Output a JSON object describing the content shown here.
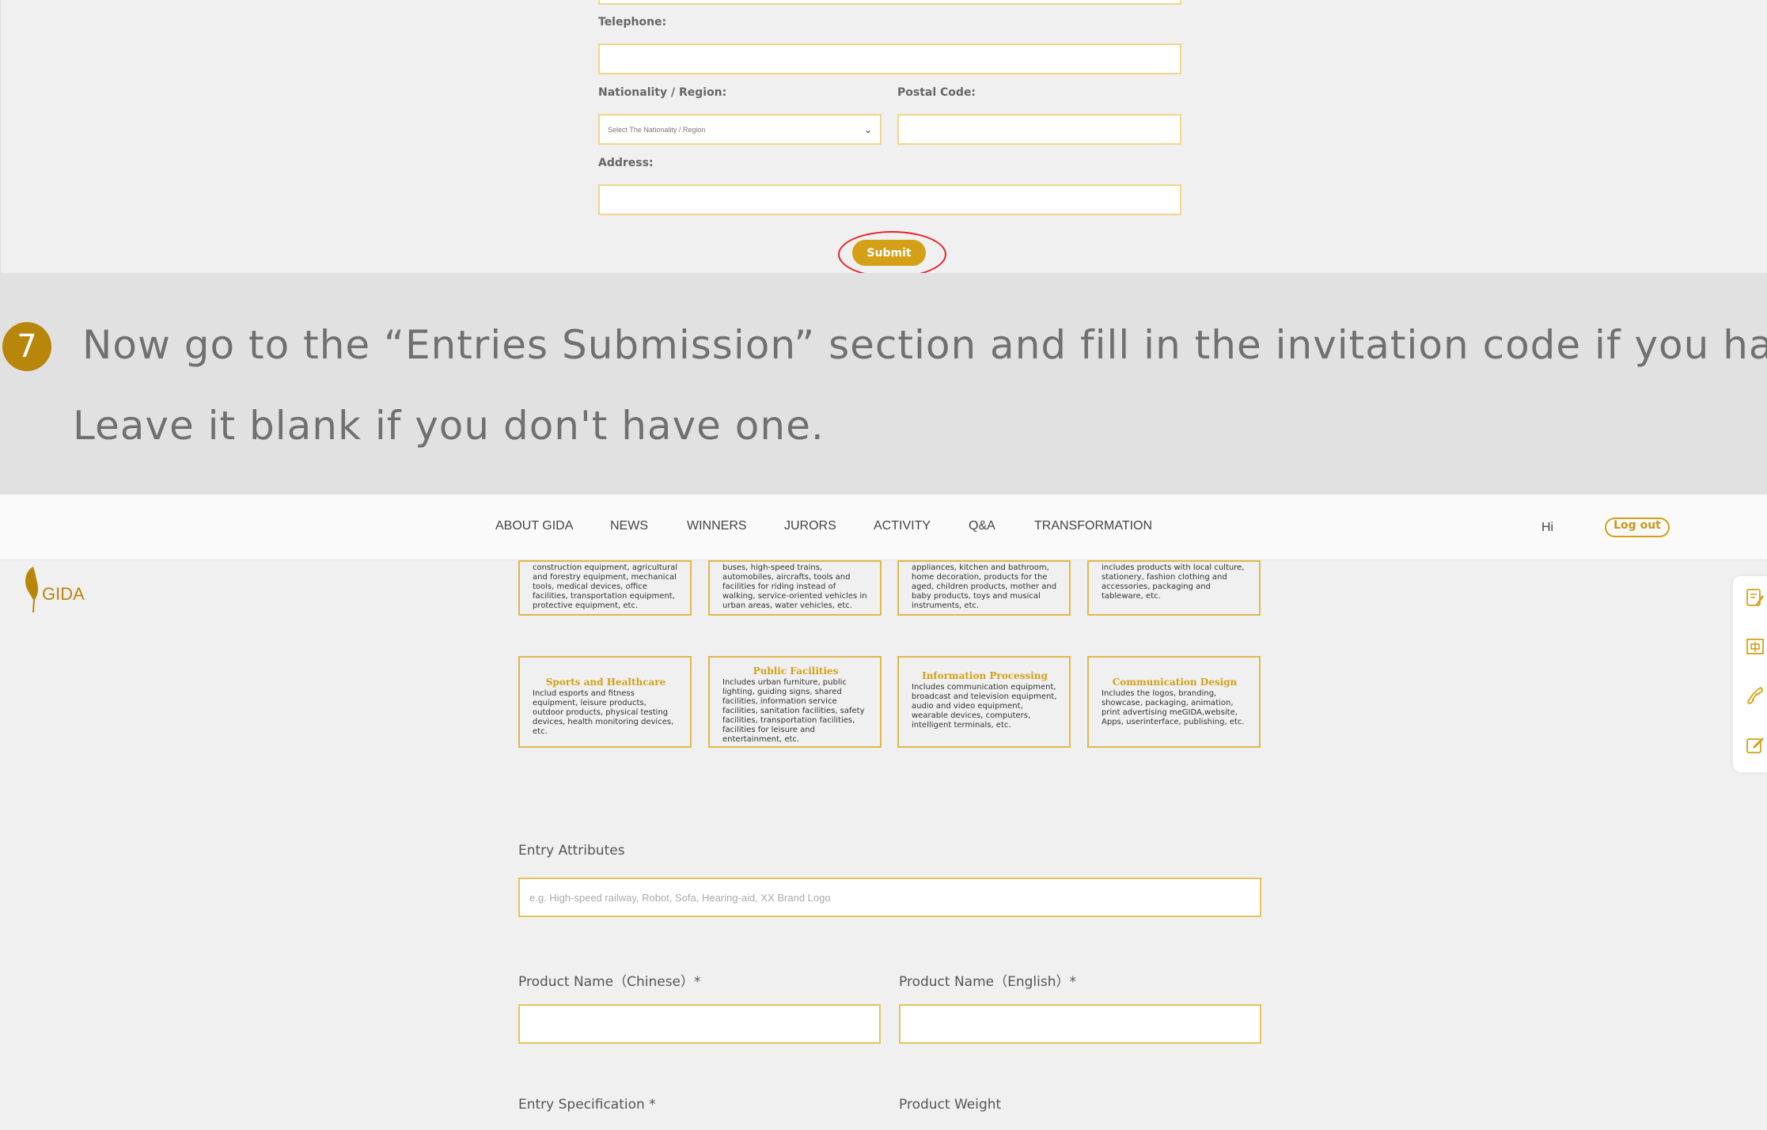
{
  "form": {
    "telephone_label": "Telephone:",
    "nationality_label": "Nationality / Region:",
    "nationality_selected": "Select The Nationality / Region",
    "postal_label": "Postal Code:",
    "address_label": "Address:",
    "submit_label": "Submit"
  },
  "instruction": {
    "step_number": "7",
    "line1": "Now go to the “Entries Submission” section and fill in the invitation code if you have it.",
    "line2": "Leave it blank if you don't have one."
  },
  "nav": {
    "items": [
      "ABOUT GIDA",
      "NEWS",
      "WINNERS",
      "JURORS",
      "ACTIVITY",
      "Q&A",
      "TRANSFORMATION"
    ],
    "greeting": "Hi",
    "logout_label": "Log out"
  },
  "logo": {
    "text": "GIDA"
  },
  "categories_row1": [
    {
      "desc": "construction equipment, agricultural and forestry equipment, mechanical tools, medical devices, office facilities, transportation equipment, protective equipment, etc."
    },
    {
      "desc": "buses, high-speed trains, automobiles, aircrafts, tools and facilities for riding instead of walking, service-oriented vehicles in urban areas, water vehicles, etc."
    },
    {
      "desc": "appliances, kitchen and bathroom, home decoration, products for the aged, children products, mother and baby products, toys and musical instruments, etc."
    },
    {
      "desc": "includes products with local culture, stationery, fashion clothing and accessories, packaging and tableware, etc."
    }
  ],
  "categories_row2": [
    {
      "title": "Sports and Healthcare",
      "desc": "Includ esports and fitness equipment, leisure products, outdoor products, physical testing devices, health monitoring devices, etc."
    },
    {
      "title": "Public Facilities",
      "desc": "Includes urban furniture, public lighting, guiding signs, shared facilities, information service facilities, sanitation facilities, safety facilities, transportation facilities, facilities for leisure and entertainment, etc."
    },
    {
      "title": "Information Processing",
      "desc": "Includes communication equipment, broadcast and television equipment, audio and video equipment, wearable devices, computers, intelligent terminals, etc."
    },
    {
      "title": "Communication Design",
      "desc": "Includes the logos, branding, showcase, packaging, animation, print advertising meGIDA,website, Apps, userinterface, publishing, etc."
    }
  ],
  "entry": {
    "attributes_label": "Entry Attributes",
    "attributes_placeholder": "e.g. High-speed railway, Robot, Sofa, Hearing-aid, XX Brand Logo",
    "name_cn_label": "Product Name（Chinese）*",
    "name_en_label": "Product Name（English）*",
    "spec_label": "Entry Specification *",
    "weight_label": "Product Weight"
  },
  "icons": {
    "side_tools": [
      "edit-form-icon",
      "language-cn-icon",
      "phone-icon",
      "write-icon"
    ]
  },
  "colors": {
    "gold": "#d4a017",
    "input_border": "#f1d58a",
    "highlight_ring": "#e8202a"
  }
}
